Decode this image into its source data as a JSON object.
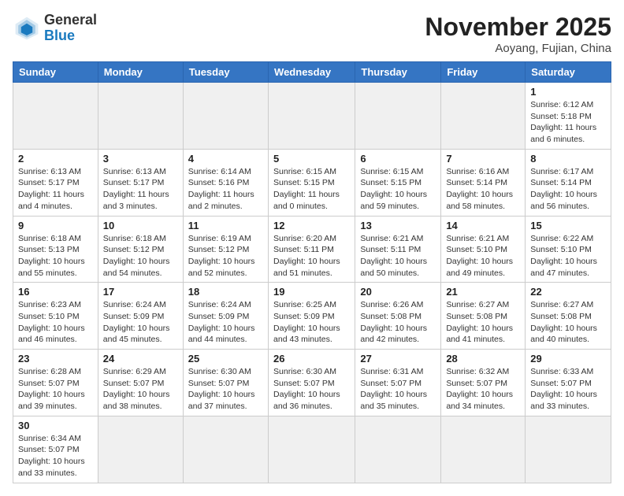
{
  "header": {
    "logo_general": "General",
    "logo_blue": "Blue",
    "month_title": "November 2025",
    "subtitle": "Aoyang, Fujian, China"
  },
  "weekdays": [
    "Sunday",
    "Monday",
    "Tuesday",
    "Wednesday",
    "Thursday",
    "Friday",
    "Saturday"
  ],
  "weeks": [
    [
      {
        "day": "",
        "info": ""
      },
      {
        "day": "",
        "info": ""
      },
      {
        "day": "",
        "info": ""
      },
      {
        "day": "",
        "info": ""
      },
      {
        "day": "",
        "info": ""
      },
      {
        "day": "",
        "info": ""
      },
      {
        "day": "1",
        "info": "Sunrise: 6:12 AM\nSunset: 5:18 PM\nDaylight: 11 hours and 6 minutes."
      }
    ],
    [
      {
        "day": "2",
        "info": "Sunrise: 6:13 AM\nSunset: 5:17 PM\nDaylight: 11 hours and 4 minutes."
      },
      {
        "day": "3",
        "info": "Sunrise: 6:13 AM\nSunset: 5:17 PM\nDaylight: 11 hours and 3 minutes."
      },
      {
        "day": "4",
        "info": "Sunrise: 6:14 AM\nSunset: 5:16 PM\nDaylight: 11 hours and 2 minutes."
      },
      {
        "day": "5",
        "info": "Sunrise: 6:15 AM\nSunset: 5:15 PM\nDaylight: 11 hours and 0 minutes."
      },
      {
        "day": "6",
        "info": "Sunrise: 6:15 AM\nSunset: 5:15 PM\nDaylight: 10 hours and 59 minutes."
      },
      {
        "day": "7",
        "info": "Sunrise: 6:16 AM\nSunset: 5:14 PM\nDaylight: 10 hours and 58 minutes."
      },
      {
        "day": "8",
        "info": "Sunrise: 6:17 AM\nSunset: 5:14 PM\nDaylight: 10 hours and 56 minutes."
      }
    ],
    [
      {
        "day": "9",
        "info": "Sunrise: 6:18 AM\nSunset: 5:13 PM\nDaylight: 10 hours and 55 minutes."
      },
      {
        "day": "10",
        "info": "Sunrise: 6:18 AM\nSunset: 5:12 PM\nDaylight: 10 hours and 54 minutes."
      },
      {
        "day": "11",
        "info": "Sunrise: 6:19 AM\nSunset: 5:12 PM\nDaylight: 10 hours and 52 minutes."
      },
      {
        "day": "12",
        "info": "Sunrise: 6:20 AM\nSunset: 5:11 PM\nDaylight: 10 hours and 51 minutes."
      },
      {
        "day": "13",
        "info": "Sunrise: 6:21 AM\nSunset: 5:11 PM\nDaylight: 10 hours and 50 minutes."
      },
      {
        "day": "14",
        "info": "Sunrise: 6:21 AM\nSunset: 5:10 PM\nDaylight: 10 hours and 49 minutes."
      },
      {
        "day": "15",
        "info": "Sunrise: 6:22 AM\nSunset: 5:10 PM\nDaylight: 10 hours and 47 minutes."
      }
    ],
    [
      {
        "day": "16",
        "info": "Sunrise: 6:23 AM\nSunset: 5:10 PM\nDaylight: 10 hours and 46 minutes."
      },
      {
        "day": "17",
        "info": "Sunrise: 6:24 AM\nSunset: 5:09 PM\nDaylight: 10 hours and 45 minutes."
      },
      {
        "day": "18",
        "info": "Sunrise: 6:24 AM\nSunset: 5:09 PM\nDaylight: 10 hours and 44 minutes."
      },
      {
        "day": "19",
        "info": "Sunrise: 6:25 AM\nSunset: 5:09 PM\nDaylight: 10 hours and 43 minutes."
      },
      {
        "day": "20",
        "info": "Sunrise: 6:26 AM\nSunset: 5:08 PM\nDaylight: 10 hours and 42 minutes."
      },
      {
        "day": "21",
        "info": "Sunrise: 6:27 AM\nSunset: 5:08 PM\nDaylight: 10 hours and 41 minutes."
      },
      {
        "day": "22",
        "info": "Sunrise: 6:27 AM\nSunset: 5:08 PM\nDaylight: 10 hours and 40 minutes."
      }
    ],
    [
      {
        "day": "23",
        "info": "Sunrise: 6:28 AM\nSunset: 5:07 PM\nDaylight: 10 hours and 39 minutes."
      },
      {
        "day": "24",
        "info": "Sunrise: 6:29 AM\nSunset: 5:07 PM\nDaylight: 10 hours and 38 minutes."
      },
      {
        "day": "25",
        "info": "Sunrise: 6:30 AM\nSunset: 5:07 PM\nDaylight: 10 hours and 37 minutes."
      },
      {
        "day": "26",
        "info": "Sunrise: 6:30 AM\nSunset: 5:07 PM\nDaylight: 10 hours and 36 minutes."
      },
      {
        "day": "27",
        "info": "Sunrise: 6:31 AM\nSunset: 5:07 PM\nDaylight: 10 hours and 35 minutes."
      },
      {
        "day": "28",
        "info": "Sunrise: 6:32 AM\nSunset: 5:07 PM\nDaylight: 10 hours and 34 minutes."
      },
      {
        "day": "29",
        "info": "Sunrise: 6:33 AM\nSunset: 5:07 PM\nDaylight: 10 hours and 33 minutes."
      }
    ],
    [
      {
        "day": "30",
        "info": "Sunrise: 6:34 AM\nSunset: 5:07 PM\nDaylight: 10 hours and 33 minutes."
      },
      {
        "day": "",
        "info": ""
      },
      {
        "day": "",
        "info": ""
      },
      {
        "day": "",
        "info": ""
      },
      {
        "day": "",
        "info": ""
      },
      {
        "day": "",
        "info": ""
      },
      {
        "day": "",
        "info": ""
      }
    ]
  ]
}
